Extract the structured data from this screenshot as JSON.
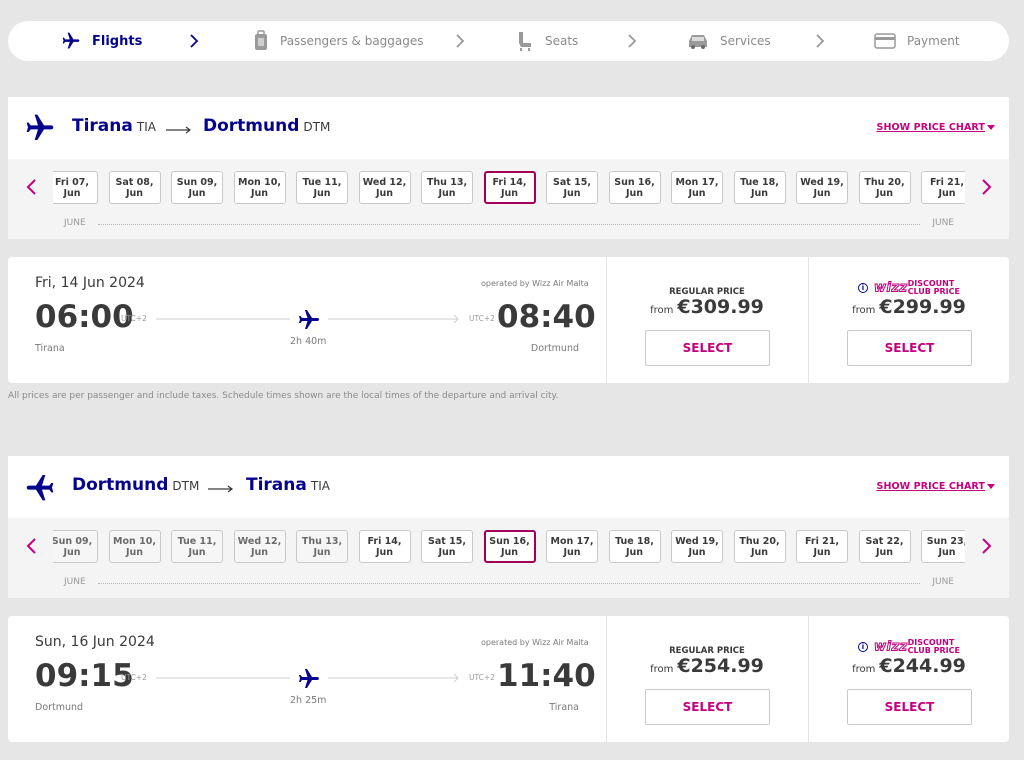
{
  "nav": {
    "steps": [
      {
        "label": "Flights",
        "active": true
      },
      {
        "label": "Passengers & baggages",
        "active": false
      },
      {
        "label": "Seats",
        "active": false
      },
      {
        "label": "Services",
        "active": false
      },
      {
        "label": "Payment",
        "active": false
      }
    ]
  },
  "outbound": {
    "from_city": "Tirana",
    "from_code": "TIA",
    "to_city": "Dortmund",
    "to_code": "DTM",
    "price_chart": "SHOW PRICE CHART",
    "dates": [
      {
        "day": "Fri 07,",
        "mon": "Jun"
      },
      {
        "day": "Sat 08,",
        "mon": "Jun"
      },
      {
        "day": "Sun 09,",
        "mon": "Jun"
      },
      {
        "day": "Mon 10,",
        "mon": "Jun"
      },
      {
        "day": "Tue 11,",
        "mon": "Jun"
      },
      {
        "day": "Wed 12,",
        "mon": "Jun"
      },
      {
        "day": "Thu 13,",
        "mon": "Jun"
      },
      {
        "day": "Fri 14,",
        "mon": "Jun"
      },
      {
        "day": "Sat 15,",
        "mon": "Jun"
      },
      {
        "day": "Sun 16,",
        "mon": "Jun"
      },
      {
        "day": "Mon 17,",
        "mon": "Jun"
      },
      {
        "day": "Tue 18,",
        "mon": "Jun"
      },
      {
        "day": "Wed 19,",
        "mon": "Jun"
      },
      {
        "day": "Thu 20,",
        "mon": "Jun"
      },
      {
        "day": "Fri 21,",
        "mon": "Jun"
      }
    ],
    "selected_index": 7,
    "month_left": "JUNE",
    "month_right": "JUNE",
    "flight": {
      "date": "Fri, 14 Jun 2024",
      "operated_by": "operated by Wizz Air Malta",
      "dep_time": "06:00",
      "dep_utc": "UTC+2",
      "dep_city": "Tirana",
      "arr_time": "08:40",
      "arr_utc": "UTC+2",
      "arr_city": "Dortmund",
      "duration": "2h 40m",
      "regular_label": "REGULAR PRICE",
      "regular_from": "from",
      "regular_price": "€309.99",
      "club_info": "i",
      "club_brand": "wizz",
      "club_line1": "DISCOUNT",
      "club_line2": "CLUB PRICE",
      "club_from": "from",
      "club_price": "€299.99",
      "select": "SELECT"
    }
  },
  "disclaimer": "All prices are per passenger and include taxes. Schedule times shown are the local times of the departure and arrival city.",
  "return": {
    "from_city": "Dortmund",
    "from_code": "DTM",
    "to_city": "Tirana",
    "to_code": "TIA",
    "price_chart": "SHOW PRICE CHART",
    "dates": [
      {
        "day": "Sun 09,",
        "mon": "Jun"
      },
      {
        "day": "Mon 10,",
        "mon": "Jun"
      },
      {
        "day": "Tue 11,",
        "mon": "Jun"
      },
      {
        "day": "Wed 12,",
        "mon": "Jun"
      },
      {
        "day": "Thu 13,",
        "mon": "Jun"
      },
      {
        "day": "Fri 14,",
        "mon": "Jun"
      },
      {
        "day": "Sat 15,",
        "mon": "Jun"
      },
      {
        "day": "Sun 16,",
        "mon": "Jun"
      },
      {
        "day": "Mon 17,",
        "mon": "Jun"
      },
      {
        "day": "Tue 18,",
        "mon": "Jun"
      },
      {
        "day": "Wed 19,",
        "mon": "Jun"
      },
      {
        "day": "Thu 20,",
        "mon": "Jun"
      },
      {
        "day": "Fri 21,",
        "mon": "Jun"
      },
      {
        "day": "Sat 22,",
        "mon": "Jun"
      },
      {
        "day": "Sun 23,",
        "mon": "Jun"
      }
    ],
    "selected_index": 7,
    "disabled_count": 5,
    "month_left": "JUNE",
    "month_right": "JUNE",
    "flight": {
      "date": "Sun, 16 Jun 2024",
      "operated_by": "operated by Wizz Air Malta",
      "dep_time": "09:15",
      "dep_utc": "UTC+2",
      "dep_city": "Dortmund",
      "arr_time": "11:40",
      "arr_utc": "UTC+2",
      "arr_city": "Tirana",
      "duration": "2h 25m",
      "regular_label": "REGULAR PRICE",
      "regular_from": "from",
      "regular_price": "€254.99",
      "club_info": "i",
      "club_brand": "wizz",
      "club_line1": "DISCOUNT",
      "club_line2": "CLUB PRICE",
      "club_from": "from",
      "club_price": "€244.99",
      "select": "SELECT"
    }
  },
  "colors": {
    "brand_blue": "#06038d",
    "brand_magenta": "#c6007e",
    "selected_border": "#a3005a"
  }
}
